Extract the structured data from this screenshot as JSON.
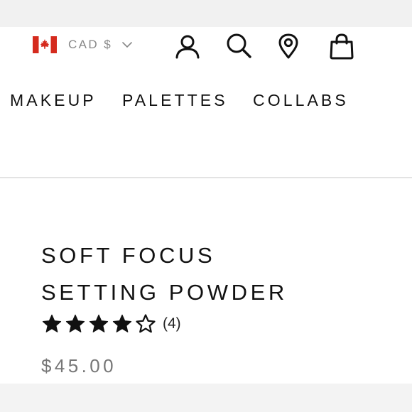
{
  "header": {
    "currency": {
      "label": "CAD $",
      "flag": "canada-flag-icon",
      "chevron": "chevron-down-icon"
    },
    "icons": [
      "account-icon",
      "search-icon",
      "store-locator-icon",
      "shopping-bag-icon"
    ]
  },
  "nav": {
    "items": [
      "MAKEUP",
      "PALETTES",
      "COLLABS"
    ]
  },
  "product": {
    "title_lines": [
      "SOFT FOCUS",
      "SETTING POWDER"
    ],
    "rating": {
      "value": 4,
      "max": 5,
      "count_label": "(4)"
    },
    "price": "$45.00"
  },
  "colors": {
    "text": "#111111",
    "muted": "#888888",
    "price": "#777777",
    "flag_red": "#d52b1e",
    "divider": "#e3e3e3"
  }
}
